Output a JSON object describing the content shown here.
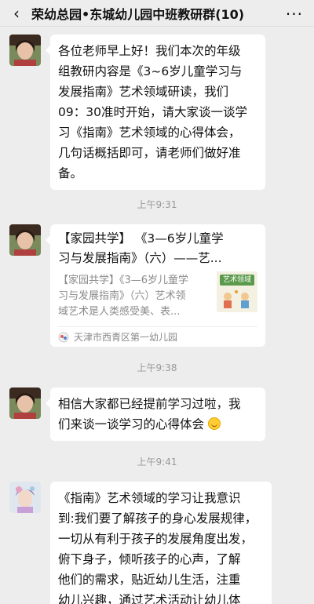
{
  "header": {
    "back_icon": "‹",
    "title": "荣幼总园•东城幼儿园中班教研群(10)",
    "more_icon": "···"
  },
  "messages": [
    {
      "type": "text",
      "lines": [
        "各位老师早上好！我们本次的年级",
        "组教研内容是《3~6岁儿童学习与",
        "发展指南》艺术领域研读，我们",
        "09：30准时开始，请大家谈一谈学",
        "习《指南》艺术领域的心得体会，",
        "几句话概括即可，请老师们做好准",
        "备。"
      ]
    },
    {
      "type": "time",
      "text": "上午9:31"
    },
    {
      "type": "card",
      "title_lines": [
        "【家园共学】 《3—6岁儿童学",
        "习与发展指南》（六）——艺..."
      ],
      "desc_lines": [
        "【家园共学】《3—6岁儿童学",
        "习与发展指南》（六）艺术领",
        "域艺术是人类感受美、表..."
      ],
      "thumb_text": "艺术领域",
      "source": "天津市西青区第一幼儿园"
    },
    {
      "type": "time",
      "text": "上午9:38"
    },
    {
      "type": "text",
      "lines": [
        "相信大家都已经提前学习过啦，我",
        "们来谈一谈学习的心得体会"
      ],
      "emoji": "smile-emoji"
    },
    {
      "type": "time",
      "text": "上午9:41"
    },
    {
      "type": "text",
      "lines": [
        "《指南》艺术领域的学习让我意识",
        "到:我们要了解孩子的身心发展规律，",
        "一切从有利于孩子的发展角度出发，",
        "俯下身子，倾听孩子的心声，了解",
        "他们的需求，贴近幼儿生活，注重",
        "幼儿兴趣，通过艺术活动让幼儿体"
      ]
    }
  ],
  "colors": {
    "background": "#ededed",
    "bubble": "#ffffff",
    "time_text": "#9a9a9a"
  }
}
